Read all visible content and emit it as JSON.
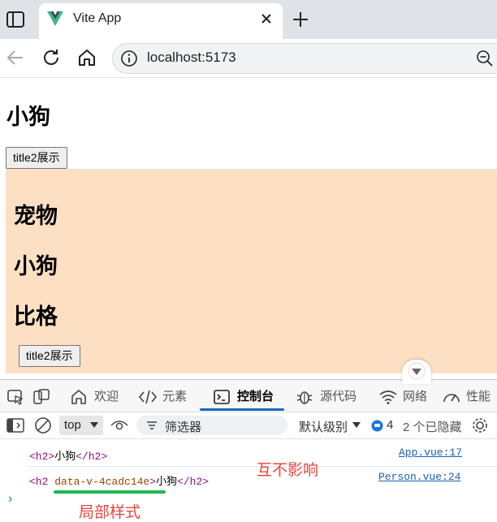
{
  "browser": {
    "tab_title": "Vite App",
    "url": "localhost:5173"
  },
  "page": {
    "app_heading": "小狗",
    "app_button": "title2展示",
    "person": {
      "heading_1": "宠物",
      "heading_2": "小狗",
      "heading_3": "比格",
      "button": "title2展示",
      "background": "#fde0c4"
    }
  },
  "devtools": {
    "tabs": [
      {
        "label": "欢迎",
        "icon": "home-icon"
      },
      {
        "label": "元素",
        "icon": "code-icon"
      },
      {
        "label": "控制台",
        "icon": "console-icon",
        "active": true
      },
      {
        "label": "源代码",
        "icon": "bug-icon"
      },
      {
        "label": "网络",
        "icon": "wifi-icon"
      },
      {
        "label": "性能",
        "icon": "gauge-icon"
      }
    ],
    "toolbar": {
      "context": "top",
      "filter_placeholder": "筛选器",
      "level": "默认级别",
      "issues_count": "4",
      "hidden": "2 个已隐藏"
    },
    "messages": [
      {
        "open_tag": "<h2>",
        "text": "小狗",
        "close_tag": "</h2>",
        "source": "App.vue:17"
      },
      {
        "open_tag_start": "<h2 ",
        "attr": "data-v-4cadc14e",
        "open_tag_end": ">",
        "text": "小狗",
        "close_tag": "</h2>",
        "source": "Person.vue:24"
      }
    ],
    "annotations": {
      "no_interference": "互不影响",
      "scoped_style": "局部样式"
    }
  },
  "colors": {
    "accent": "#0f6cbd",
    "annotation": "#e8453c",
    "underline": "#1db954"
  }
}
